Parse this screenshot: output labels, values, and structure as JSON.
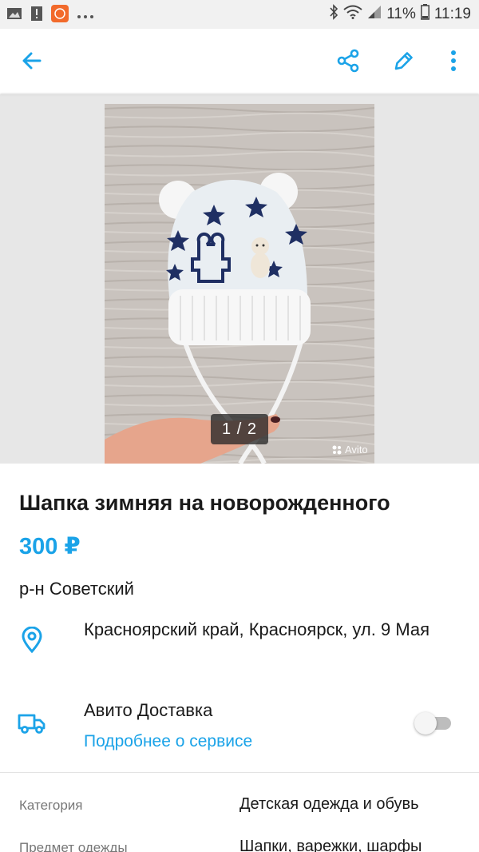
{
  "status_bar": {
    "battery": "11%",
    "time": "11:19",
    "icons": [
      "image-icon",
      "alert-icon",
      "app-notification-icon",
      "more-dots-icon",
      "bluetooth-icon",
      "wifi-icon",
      "signal-icon",
      "battery-icon"
    ]
  },
  "app_bar": {
    "back_icon": "arrow-left-icon",
    "share_icon": "share-icon",
    "edit_icon": "pencil-icon",
    "menu_icon": "more-vertical-icon"
  },
  "gallery": {
    "counter": "1 / 2",
    "watermark": "Avito"
  },
  "listing": {
    "title": "Шапка зимняя на новорожденного",
    "price": "300 ₽",
    "district": "р-н Советский",
    "address": "Красноярский край, Красноярск, ул. 9 Мая",
    "delivery_title": "Авито Доставка",
    "delivery_link": "Подробнее о сервисе",
    "delivery_enabled": false
  },
  "params": [
    {
      "label": "Категория",
      "value": "Детская одежда и обувь"
    },
    {
      "label": "Предмет одежды",
      "value": "Шапки, варежки, шарфы"
    }
  ],
  "colors": {
    "accent": "#1ba3e8",
    "text": "#1a1a1a",
    "muted": "#777777",
    "gallery_bg": "#e7e7e7"
  }
}
